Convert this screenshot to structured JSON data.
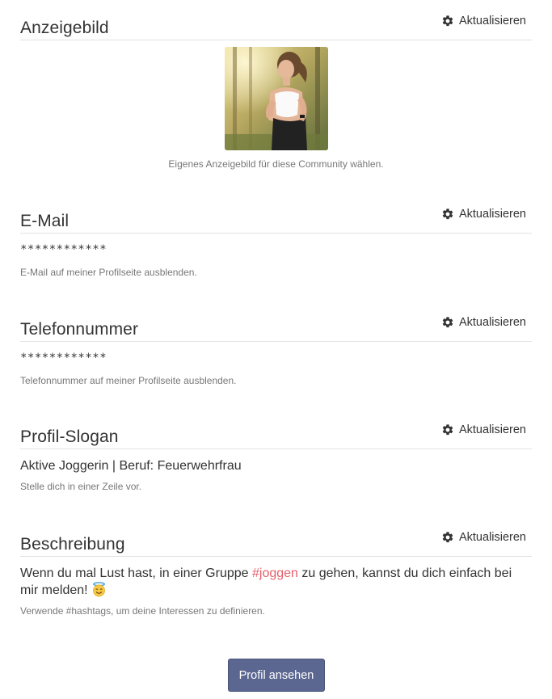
{
  "update_label": "Aktualisieren",
  "sections": {
    "avatar": {
      "title": "Anzeigebild",
      "hint": "Eigenes Anzeigebild für diese Community wählen."
    },
    "email": {
      "title": "E-Mail",
      "value": "************",
      "hint": "E-Mail auf meiner Profilseite ausblenden."
    },
    "phone": {
      "title": "Telefonnummer",
      "value": "************",
      "hint": "Telefonnummer auf meiner Profilseite ausblenden."
    },
    "slogan": {
      "title": "Profil-Slogan",
      "value": "Aktive Joggerin | Beruf: Feuerwehrfrau",
      "hint": "Stelle dich in einer Zeile vor."
    },
    "description": {
      "title": "Beschreibung",
      "text_before": "Wenn du mal Lust hast, in einer Gruppe ",
      "hashtag": "#joggen",
      "text_after": " zu gehen, kannst du dich einfach bei mir melden! ",
      "emoji": "smiling-halo-emoji",
      "hint": "Verwende #hashtags, um deine Interessen zu definieren."
    }
  },
  "view_profile_label": "Profil ansehen",
  "colors": {
    "hashtag": "#e5606b",
    "primary_button": "#5b6691",
    "divider": "#e3e3e3"
  }
}
